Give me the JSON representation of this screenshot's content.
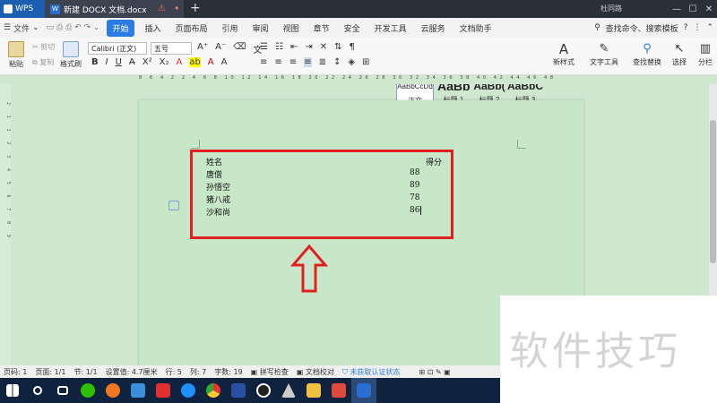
{
  "titlebar": {
    "app": "WPS",
    "doc_tab": "新建 DOCX 文档.docx",
    "user": "杜同路"
  },
  "menubar": {
    "file": "文件",
    "items": [
      "开始",
      "插入",
      "页面布局",
      "引用",
      "审阅",
      "视图",
      "章节",
      "安全",
      "开发工具",
      "云服务",
      "文档助手"
    ],
    "active": "开始",
    "search": "查找命令、搜索模板"
  },
  "ribbon": {
    "paste": "粘贴",
    "cut": "剪切",
    "copy": "复制",
    "format_painter": "格式刷",
    "font_name": "Calibri (正文)",
    "font_size": "五号",
    "styles": [
      {
        "sample": "AaBbCcDd",
        "label": "正文"
      },
      {
        "sample": "AaBb",
        "label": "标题 1"
      },
      {
        "sample": "AaBb(",
        "label": "标题 2"
      },
      {
        "sample": "AaBbC",
        "label": "标题 3"
      }
    ],
    "new_style": "新样式",
    "text_tools": "文字工具",
    "find_replace": "查找替换",
    "select": "选择",
    "columns": "分栏"
  },
  "ruler": "8 6 4 2 2 4 6 8 10 12 14 16 18 20 22 24 26 28 30 32 34 36 38 40 42 44 46 48",
  "vruler": "2 1 1 2 3 4 5 6 7 8 9",
  "table": {
    "header": {
      "name": "姓名",
      "score": "得分"
    },
    "rows": [
      {
        "name": "唐僧",
        "score": "88"
      },
      {
        "name": "孙悟空",
        "score": "89"
      },
      {
        "name": "猪八戒",
        "score": "78"
      },
      {
        "name": "沙和尚",
        "score": "86"
      }
    ]
  },
  "statusbar": {
    "page_no": "页码: 1",
    "pages": "页面: 1/1",
    "section": "节: 1/1",
    "setting": "设置值: 4.7厘米",
    "row": "行: 5",
    "col": "列: 7",
    "words": "字数: 19",
    "spell": "拼写检查",
    "proof": "文档校对",
    "auth": "未获取认证状态"
  },
  "watermark": "软件技巧",
  "colors": {
    "accent": "#2a7be4",
    "highlight": "#e02020",
    "page": "#c8e6c8"
  }
}
